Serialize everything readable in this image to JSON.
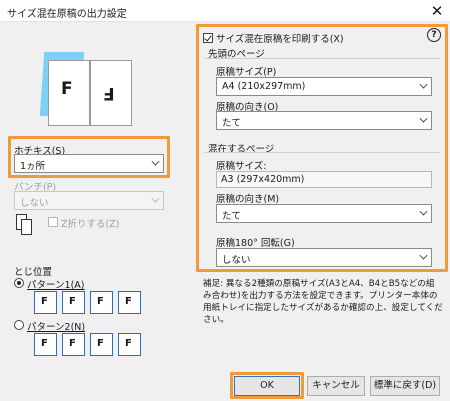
{
  "window": {
    "title": "サイズ混在原稿の出力設定",
    "close_glyph": "✕"
  },
  "left": {
    "staple_label": "ホチキス(S)",
    "staple_value": "1ヵ所",
    "punch_label": "パンチ(P)",
    "punch_value": "しない",
    "zfold_label": "Z折りする(Z)",
    "binding_label": "とじ位置",
    "pattern1_label": "パターン1(A)",
    "pattern2_label": "パターン2(N)",
    "pattern1_letters": [
      "F",
      "F",
      "F",
      "F"
    ],
    "pattern2_letters": [
      "F",
      "F",
      "F",
      "F"
    ]
  },
  "right": {
    "print_mixed_label": "サイズ混在原稿を印刷する(X)",
    "help_glyph": "?",
    "first_page_header": "先頭のページ",
    "orig_size_label": "原稿サイズ(P)",
    "orig_size_value": "A4 (210x297mm)",
    "orient_label": "原稿の向き(O)",
    "orient_value": "たて",
    "mixed_page_header": "混在するページ",
    "mixed_size_label": "原稿サイズ:",
    "mixed_size_value": "A3 (297x420mm)",
    "mixed_orient_label": "原稿の向き(M)",
    "mixed_orient_value": "たて",
    "rotate_label": "原稿180° 回転(G)",
    "rotate_value": "しない"
  },
  "note": "補足: 異なる2種類の原稿サイズ(A3とA4、B4とB5などの組み合わせ)を出力する方法を設定できます。プリンター本体の用紙トレイに指定したサイズがあるか確認の上、設定してください。",
  "buttons": {
    "ok": "OK",
    "cancel": "キャンセル",
    "reset": "標準に戻す(D)"
  },
  "colors": {
    "highlight": "#f29a38",
    "accent_blue": "#2a6fbd"
  }
}
